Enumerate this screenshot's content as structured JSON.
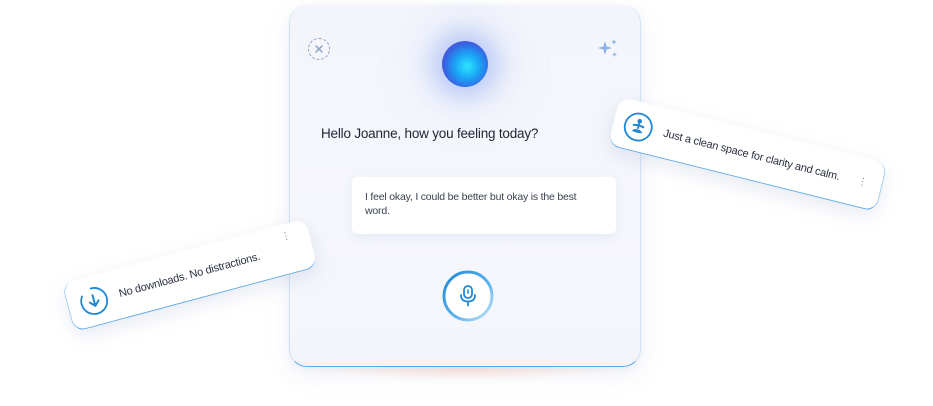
{
  "assistant": {
    "greeting": "Hello Joanne, how you feeling today?",
    "user_reply": "I feel okay, I could be better but okay is the best word.",
    "accent_color": "#1e88d6",
    "orb_colors": [
      "#2ee6ff",
      "#1aa3f5",
      "#3a5fe0",
      "#6a4ad8"
    ]
  },
  "icons": {
    "close": "close-icon",
    "sparkle": "sparkle-icon",
    "microphone": "microphone-icon",
    "meditation": "meditation-icon",
    "download": "download-icon",
    "more": "more-vertical-icon"
  },
  "chips": {
    "clarity": {
      "text": "Just a clean space for clarity and calm."
    },
    "no_downloads": {
      "text": "No downloads. No distractions."
    }
  },
  "more_glyph": "⋮"
}
